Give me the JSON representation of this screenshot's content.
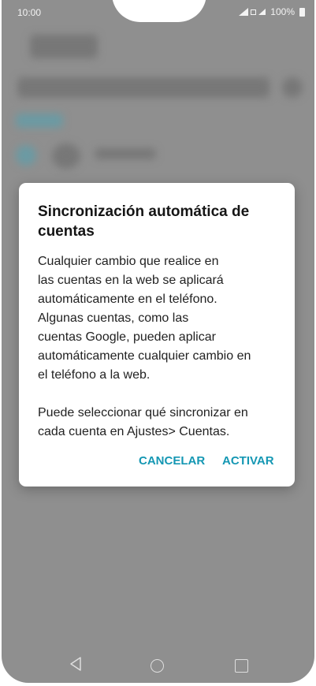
{
  "status_bar": {
    "time": "10:00",
    "battery": "100%"
  },
  "dialog": {
    "title": "Sincronización automática de cuentas",
    "message_lines": [
      "Cualquier cambio que realice en",
      "las cuentas en la web se aplicará",
      "automáticamente en el teléfono.",
      "Algunas cuentas, como las",
      "cuentas Google, pueden aplicar",
      "automáticamente cualquier cambio en",
      "el teléfono a la web."
    ],
    "message_lines_2": [
      "Puede seleccionar qué sincronizar en",
      "cada cuenta en Ajustes> Cuentas."
    ],
    "cancel_label": "CANCELAR",
    "ok_label": "ACTIVAR"
  },
  "colors": {
    "accent": "#1497b3",
    "scrim": "#8f8f8f"
  },
  "icons": {
    "back": "back-triangle-icon",
    "home": "home-circle-icon",
    "recents": "recents-square-icon"
  }
}
